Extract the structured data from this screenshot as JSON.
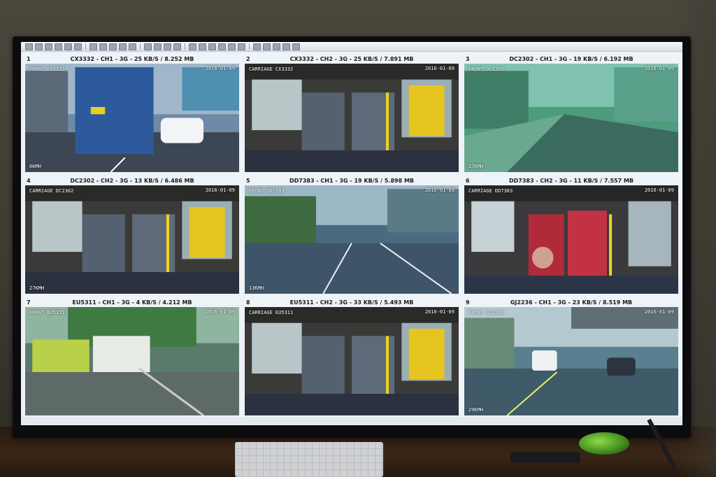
{
  "cameras": [
    {
      "index": "1",
      "title": "CX3332 - CH1 - 3G - 25 KB/S / 8.252 MB",
      "osd_cam": "FRONT CX3332",
      "osd_speed": "6KMH",
      "scene": "road-truck"
    },
    {
      "index": "2",
      "title": "CX3332 - CH2 - 3G - 25 KB/S / 7.891 MB",
      "osd_cam": "CARRIAGE CX3332",
      "osd_speed": "",
      "scene": "interior"
    },
    {
      "index": "3",
      "title": "DC2302 - CH1 - 3G - 19 KB/S / 6.192 MB",
      "osd_cam": "FRONT DC2302",
      "osd_speed": "27KMH",
      "scene": "road-green"
    },
    {
      "index": "4",
      "title": "DC2302 - CH2 - 3G - 13 KB/S / 6.486 MB",
      "osd_cam": "CARRIAGE DC2302",
      "osd_speed": "27KMH",
      "scene": "interior"
    },
    {
      "index": "5",
      "title": "DD7383 - CH1 - 3G - 19 KB/S / 5.898 MB",
      "osd_cam": "FRONT DD7383",
      "osd_speed": "13KMH",
      "scene": "road-open"
    },
    {
      "index": "6",
      "title": "DD7383 - CH2 - 3G - 11 KB/S / 7.557 MB",
      "osd_cam": "CARRIAGE DD7383",
      "osd_speed": "",
      "scene": "interior-red"
    },
    {
      "index": "7",
      "title": "EU5311 - CH1 - 3G - 4 KB/S / 4.212 MB",
      "osd_cam": "FRONT EU5311",
      "osd_speed": "",
      "scene": "road-bus"
    },
    {
      "index": "8",
      "title": "EU5311 - CH2 - 3G - 33 KB/S / 5.493 MB",
      "osd_cam": "CARRIAGE EU5311",
      "osd_speed": "",
      "scene": "interior"
    },
    {
      "index": "9",
      "title": "GJ2236 - CH1 - 3G - 23 KB/S / 8.519 MB",
      "osd_cam": "FRONT GJ2236",
      "osd_speed": "29KMH",
      "scene": "road-cars"
    }
  ],
  "osd_timestamp": "2016-01-09",
  "colors": {
    "screen_bg": "#eef3f8",
    "header_text": "#1a1a1a",
    "mouse_accent": "#5fbf2a"
  }
}
